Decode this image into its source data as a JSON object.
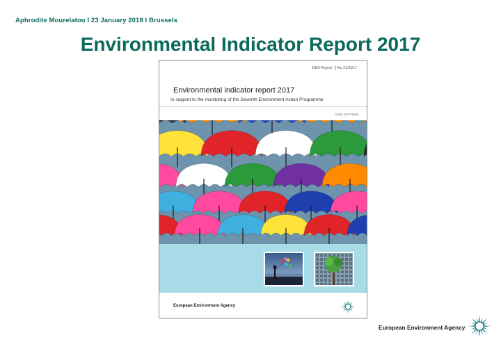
{
  "header": {
    "meta_line": "Aphrodite Mourelatou I 23 January 2018 I Brussels"
  },
  "slide": {
    "title": "Environmental Indicator Report 2017"
  },
  "cover": {
    "series_label": "EEA Report",
    "report_number": "No 21/2017",
    "title": "Environmental indicator report 2017",
    "subtitle": "In support to the monitoring of the Seventh Environment Action Programme",
    "issn": "ISSN 1977-8449",
    "agency": "European Environment Agency",
    "photo_icon": "colorful-umbrellas-photo",
    "thumbnail_icons": [
      "person-with-balloons-photo",
      "tree-in-city-photo"
    ],
    "logo_icon": "eea-sunburst-logo",
    "colors": {
      "band": "#a8dbe8",
      "umbrellas": [
        "#2a2a2a",
        "#ff8a00",
        "#1f3fae",
        "#ffe23a",
        "#e0242a",
        "#2a9a3a",
        "#ff4aa0",
        "#40b0e0",
        "#7030a0",
        "#ffffff"
      ]
    }
  },
  "footer": {
    "agency": "European Environment Agency",
    "logo_icon": "eea-sunburst-logo",
    "logo_colors": [
      "#0a6a5a",
      "#1a9ac0"
    ]
  },
  "theme": {
    "title_color": "#0b6a5a"
  }
}
